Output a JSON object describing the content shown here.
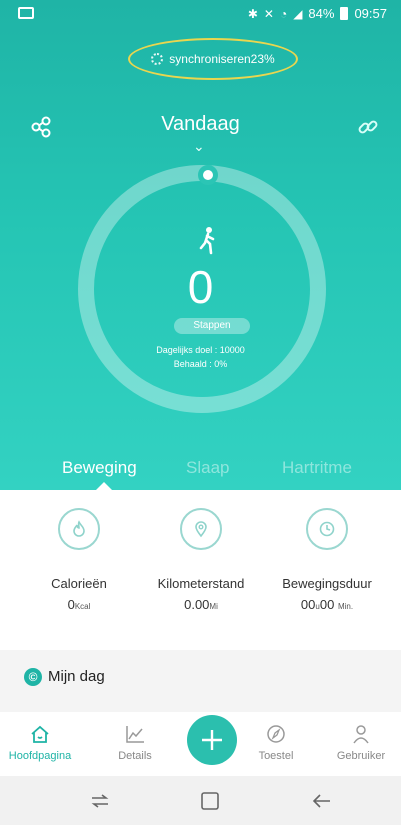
{
  "status_bar": {
    "battery": "84%",
    "time": "09:57",
    "icons": [
      "image-icon",
      "bluetooth-icon",
      "mute-icon",
      "wifi-icon",
      "signal-icon",
      "battery-icon"
    ]
  },
  "sync": {
    "label": "synchroniseren23%",
    "progress_percent": 23
  },
  "header": {
    "title": "Vandaag",
    "left_icon": "share-icon",
    "right_icon": "link-icon"
  },
  "ring": {
    "steps": "0",
    "steps_badge": "Stappen",
    "daily_goal": "Dagelijks doel : 10000",
    "achieved": "Behaald : 0%",
    "progress_fraction": 0
  },
  "tabs": [
    {
      "label": "Beweging",
      "active": true
    },
    {
      "label": "Slaap",
      "active": false
    },
    {
      "label": "Hartritme",
      "active": false
    }
  ],
  "stats": [
    {
      "icon": "flame-icon",
      "label": "Calorieën",
      "value": "0",
      "unit": "Kcal"
    },
    {
      "icon": "location-pin-icon",
      "label": "Kilometerstand",
      "value": "0.00",
      "unit": "Mi"
    },
    {
      "icon": "clock-icon",
      "label": "Bewegingsduur",
      "value": "00",
      "unit1": "u",
      "value2": "00",
      "unit2": "Min."
    }
  ],
  "mijn_dag": {
    "label": "Mijn dag"
  },
  "bottom_nav": [
    {
      "label": "Hoofdpagina",
      "icon": "home-icon",
      "active": true
    },
    {
      "label": "Details",
      "icon": "chart-icon",
      "active": false
    },
    {
      "label": "",
      "icon": "plus-icon",
      "active": false
    },
    {
      "label": "Toestel",
      "icon": "compass-icon",
      "active": false
    },
    {
      "label": "Gebruiker",
      "icon": "user-icon",
      "active": false
    }
  ],
  "colors": {
    "accent": "#1fb4a6",
    "sync_highlight": "#e9d64f"
  }
}
